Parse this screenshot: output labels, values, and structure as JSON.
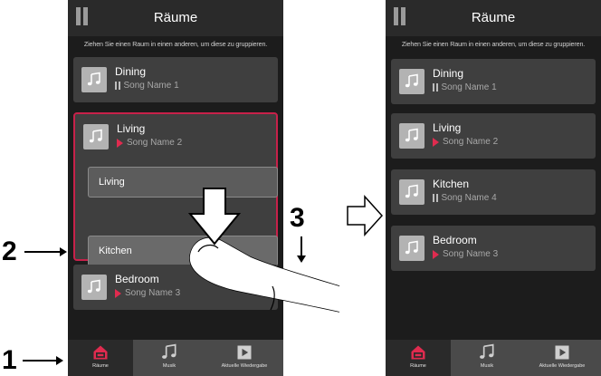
{
  "left_screen": {
    "title": "Räume",
    "hint": "Ziehen Sie einen Raum in einen anderen, um diese zu gruppieren.",
    "rooms_top": [
      {
        "name": "Dining",
        "song": "Song Name 1",
        "state": "paused"
      }
    ],
    "group": {
      "name": "Living",
      "song": "Song Name 2",
      "state": "playing",
      "members": [
        "Living",
        "Kitchen"
      ]
    },
    "rooms_bottom": [
      {
        "name": "Bedroom",
        "song": "Song Name 3",
        "state": "playing"
      }
    ],
    "tabs": [
      "Räume",
      "Musik",
      "Aktuelle Wiedergabe"
    ]
  },
  "right_screen": {
    "title": "Räume",
    "hint": "Ziehen Sie einen Raum in einen anderen, um diese zu gruppieren.",
    "rooms": [
      {
        "name": "Dining",
        "song": "Song Name 1",
        "state": "paused"
      },
      {
        "name": "Living",
        "song": "Song Name 2",
        "state": "playing"
      },
      {
        "name": "Kitchen",
        "song": "Song Name 4",
        "state": "paused"
      },
      {
        "name": "Bedroom",
        "song": "Song Name 3",
        "state": "playing"
      }
    ],
    "tabs": [
      "Räume",
      "Musik",
      "Aktuelle Wiedergabe"
    ]
  },
  "callouts": [
    "1",
    "2",
    "3"
  ],
  "colors": {
    "accent": "#e02b4f",
    "group_border": "#c7214a",
    "card_bg": "#3f3f3f",
    "screen_bg": "#1c1c1c",
    "bar_bg": "#2a2a2a"
  },
  "icons": [
    "menu-icon",
    "music-note-icon",
    "pause-icon",
    "play-icon",
    "home-icon",
    "play-button-icon",
    "hand-icon",
    "arrow-right-icon"
  ]
}
